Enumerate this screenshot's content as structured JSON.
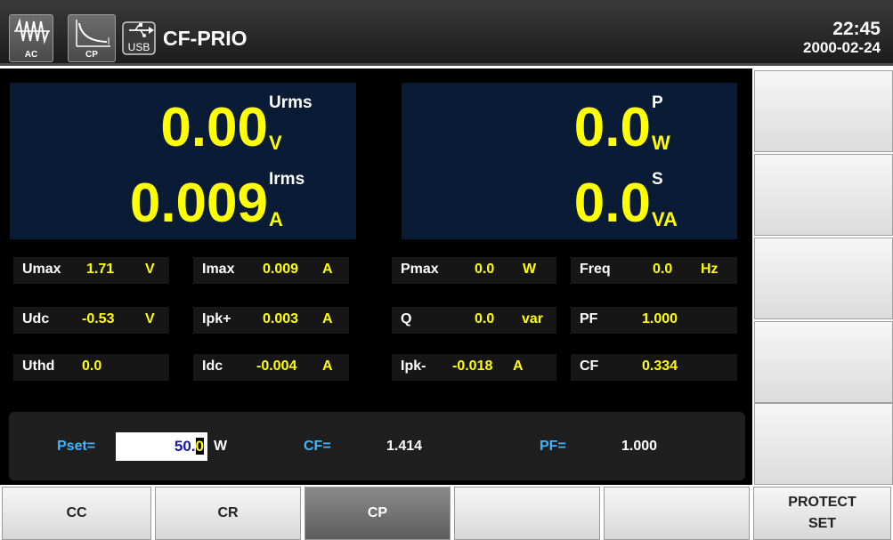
{
  "header": {
    "ac_label": "AC",
    "cp_label": "CP",
    "usb_label": "USB",
    "title": "CF-PRIO",
    "time": "22:45",
    "date": "2000-02-24"
  },
  "display": {
    "voltage": {
      "value": "0.00",
      "unit": "V",
      "label": "Urms"
    },
    "current": {
      "value": "0.009",
      "unit": "A",
      "label": "Irms"
    },
    "power": {
      "value": "0.0",
      "unit": "W",
      "label": "P"
    },
    "apparent": {
      "value": "0.0",
      "unit": "VA",
      "label": "S"
    }
  },
  "measurements": {
    "umax": {
      "label": "Umax",
      "value": "1.71",
      "unit": "V"
    },
    "imax": {
      "label": "Imax",
      "value": "0.009",
      "unit": "A"
    },
    "pmax": {
      "label": "Pmax",
      "value": "0.0",
      "unit": "W"
    },
    "freq": {
      "label": "Freq",
      "value": "0.0",
      "unit": "Hz"
    },
    "udc": {
      "label": "Udc",
      "value": "-0.53",
      "unit": "V"
    },
    "ipkp": {
      "label": "Ipk+",
      "value": "0.003",
      "unit": "A"
    },
    "q": {
      "label": "Q",
      "value": "0.0",
      "unit": "var"
    },
    "pf": {
      "label": "PF",
      "value": "1.000"
    },
    "uthd": {
      "label": "Uthd",
      "value": "0.0"
    },
    "idc": {
      "label": "Idc",
      "value": "-0.004",
      "unit": "A"
    },
    "ipkm": {
      "label": "Ipk-",
      "value": "-0.018",
      "unit": "A"
    },
    "cf": {
      "label": "CF",
      "value": "0.334"
    }
  },
  "settings": {
    "pset_label": "Pset=",
    "pset_value_main": "50.",
    "pset_value_cursor": "0",
    "pset_unit": "W",
    "cf_label": "CF=",
    "cf_value": "1.414",
    "pf_label": "PF=",
    "pf_value": "1.000"
  },
  "softkeys": {
    "right": [
      "",
      "",
      "",
      "",
      ""
    ],
    "bottom": {
      "cc": "CC",
      "cr": "CR",
      "cp": "CP",
      "key4": "",
      "key5": "",
      "protect_line1": "PROTECT",
      "protect_line2": "SET"
    },
    "active": "CP"
  },
  "colors": {
    "value_yellow": "#ffff00",
    "panel_blue": "#0a1b36",
    "settings_label_blue": "#3fb6ff",
    "pset_value_blue": "#1a1aa0"
  },
  "icons": [
    "ac-waveform-icon",
    "cp-curve-icon",
    "usb-icon"
  ]
}
